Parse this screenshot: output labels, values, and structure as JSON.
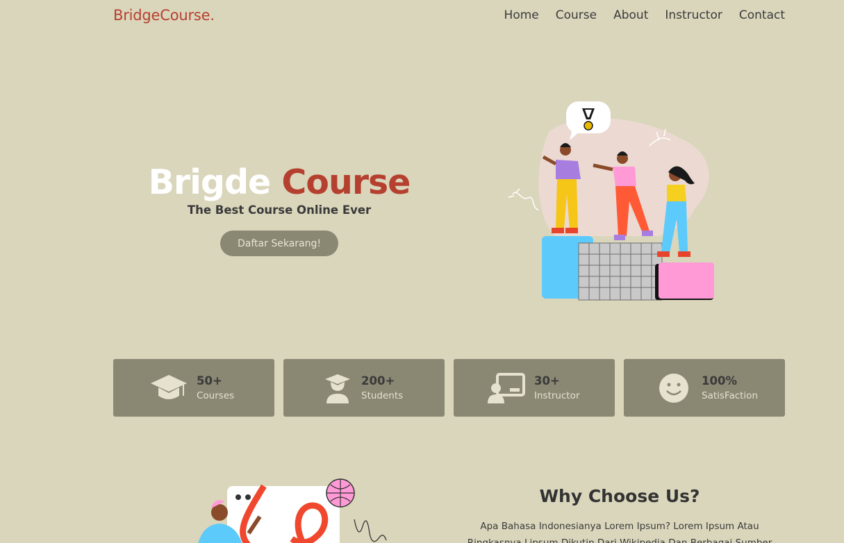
{
  "nav": {
    "brand": "BridgeCourse.",
    "items": [
      "Home",
      "Course",
      "About",
      "Instructor",
      "Contact"
    ]
  },
  "hero": {
    "title_white": "Brigde",
    "title_red": "Course",
    "subtitle": "The Best Course Online Ever",
    "cta_label": "Daftar Sekarang!"
  },
  "stats": [
    {
      "value": "50+",
      "label": "Courses",
      "icon": "graduation-cap-icon"
    },
    {
      "value": "200+",
      "label": "Students",
      "icon": "student-icon"
    },
    {
      "value": "30+",
      "label": "Instructor",
      "icon": "instructor-icon"
    },
    {
      "value": "100%",
      "label": "SatisFaction",
      "icon": "smile-icon"
    }
  ],
  "why": {
    "title": "Why Choose Us?",
    "body": "Apa Bahasa Indonesianya Lorem Ipsum? Lorem Ipsum Atau Ringkasnya Lipsum Dikutip Dari Wikipedia Dan Berbagai Sumber"
  },
  "colors": {
    "background": "#dad6bc",
    "accent": "#b5402f",
    "card": "#8a8773"
  }
}
